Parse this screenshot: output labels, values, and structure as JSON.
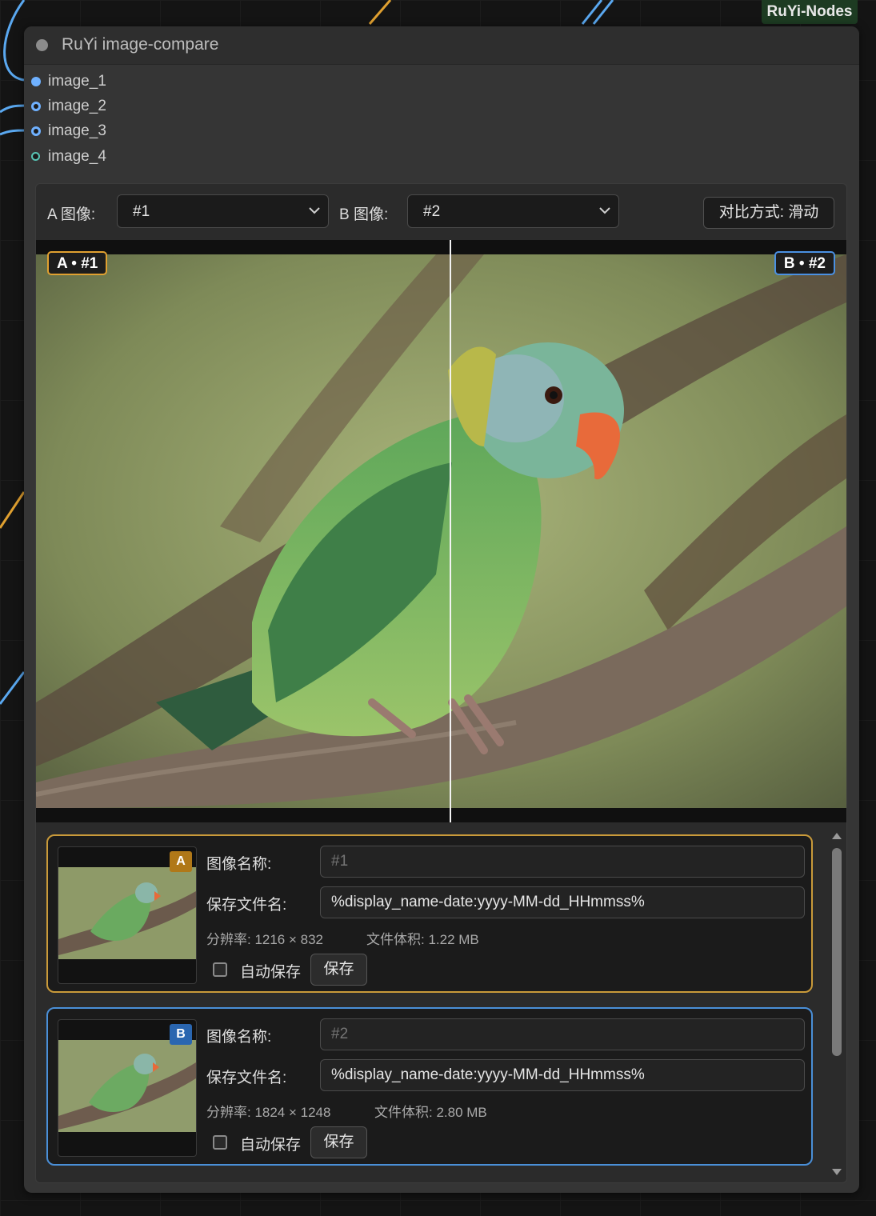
{
  "canvas": {
    "group_tag": "RuYi-Nodes"
  },
  "node": {
    "title": "RuYi image-compare",
    "inputs": [
      "image_1",
      "image_2",
      "image_3",
      "image_4"
    ]
  },
  "toolbar": {
    "a_label": "A 图像:",
    "a_value": "#1",
    "b_label": "B 图像:",
    "b_value": "#2",
    "mode_button": "对比方式: 滑动"
  },
  "viewer": {
    "badge_a": "A • #1",
    "badge_b": "B • #2"
  },
  "cards": [
    {
      "badge": "A",
      "name_label": "图像名称:",
      "name_placeholder": "#1",
      "filename_label": "保存文件名:",
      "filename_value": "%display_name-date:yyyy-MM-dd_HHmmss%",
      "resolution": "分辨率: 1216 × 832",
      "filesize": "文件体积: 1.22 MB",
      "autosave_label": "自动保存",
      "save_label": "保存"
    },
    {
      "badge": "B",
      "name_label": "图像名称:",
      "name_placeholder": "#2",
      "filename_label": "保存文件名:",
      "filename_value": "%display_name-date:yyyy-MM-dd_HHmmss%",
      "resolution": "分辨率: 1824 × 1248",
      "filesize": "文件体积: 2.80 MB",
      "autosave_label": "自动保存",
      "save_label": "保存"
    }
  ],
  "colors": {
    "accent_a": "#e0a030",
    "accent_b": "#4a90e2",
    "slot_image": "#6fb1ff",
    "group_tag_bg": "#1d3b22"
  }
}
